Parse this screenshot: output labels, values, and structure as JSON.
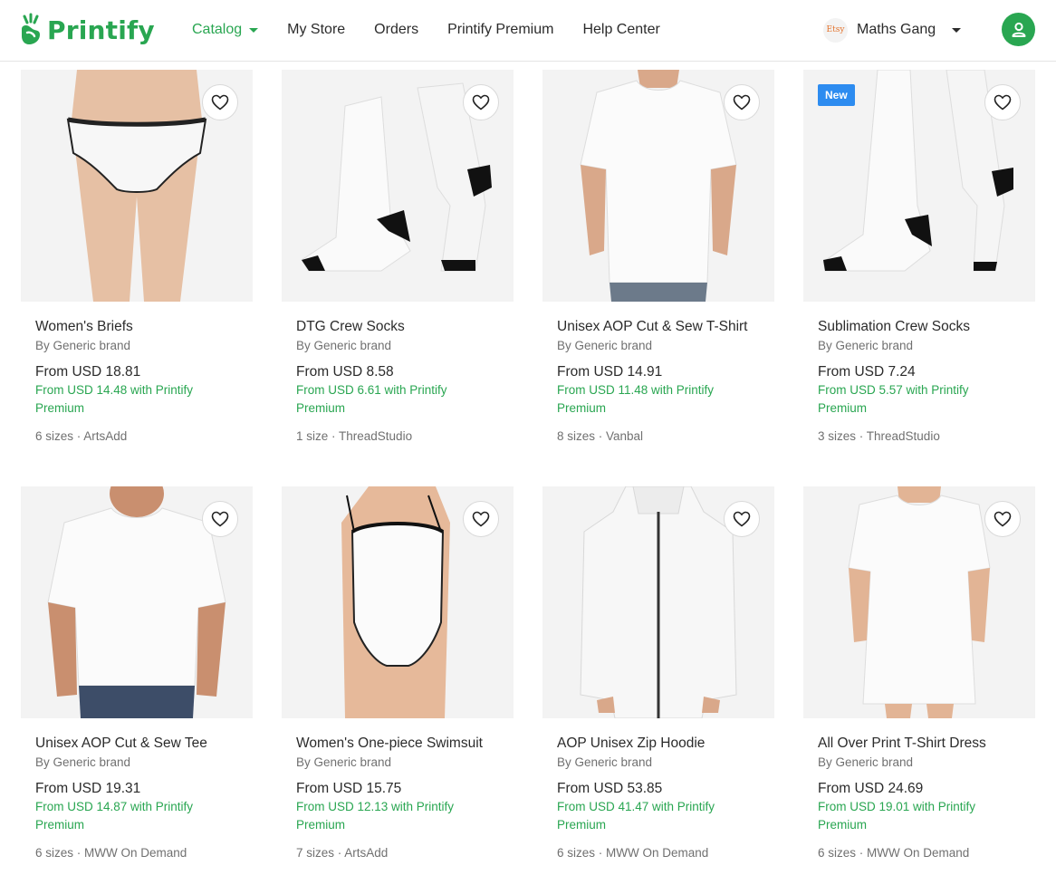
{
  "brand": {
    "logo_text": "Printify"
  },
  "nav": {
    "items": [
      {
        "label": "Catalog"
      },
      {
        "label": "My Store"
      },
      {
        "label": "Orders"
      },
      {
        "label": "Printify Premium"
      },
      {
        "label": "Help Center"
      }
    ]
  },
  "store": {
    "platform_badge": "Etsy",
    "name": "Maths Gang"
  },
  "colors": {
    "brand_green": "#29a651",
    "new_badge": "#2d8cf0"
  },
  "products": [
    {
      "title": "Women's Briefs",
      "brand": "By Generic brand",
      "price": "From USD 18.81",
      "premium": "From USD 14.48 with Printify Premium",
      "meta": "6 sizes · ArtsAdd",
      "badge": "",
      "icon": "briefs-image"
    },
    {
      "title": "DTG Crew Socks",
      "brand": "By Generic brand",
      "price": "From USD 8.58",
      "premium": "From USD 6.61 with Printify Premium",
      "meta": "1 size · ThreadStudio",
      "badge": "",
      "icon": "socks-image"
    },
    {
      "title": "Unisex AOP Cut & Sew T-Shirt",
      "brand": "By Generic brand",
      "price": "From USD 14.91",
      "premium": "From USD 11.48 with Printify Premium",
      "meta": "8 sizes · Vanbal",
      "badge": "",
      "icon": "tshirt-image"
    },
    {
      "title": "Sublimation Crew Socks",
      "brand": "By Generic brand",
      "price": "From USD 7.24",
      "premium": "From USD 5.57 with Printify Premium",
      "meta": "3 sizes · ThreadStudio",
      "badge": "New",
      "icon": "socks-image"
    },
    {
      "title": "Unisex AOP Cut & Sew Tee",
      "brand": "By Generic brand",
      "price": "From USD 19.31",
      "premium": "From USD 14.87 with Printify Premium",
      "meta": "6 sizes · MWW On Demand",
      "badge": "",
      "icon": "tshirt-image"
    },
    {
      "title": "Women's One-piece Swimsuit",
      "brand": "By Generic brand",
      "price": "From USD 15.75",
      "premium": "From USD 12.13 with Printify Premium",
      "meta": "7 sizes · ArtsAdd",
      "badge": "",
      "icon": "swimsuit-image"
    },
    {
      "title": "AOP Unisex Zip Hoodie",
      "brand": "By Generic brand",
      "price": "From USD 53.85",
      "premium": "From USD 41.47 with Printify Premium",
      "meta": "6 sizes · MWW On Demand",
      "badge": "",
      "icon": "hoodie-image"
    },
    {
      "title": "All Over Print T-Shirt Dress",
      "brand": "By Generic brand",
      "price": "From USD 24.69",
      "premium": "From USD 19.01 with Printify Premium",
      "meta": "6 sizes · MWW On Demand",
      "badge": "",
      "icon": "dress-image"
    }
  ]
}
